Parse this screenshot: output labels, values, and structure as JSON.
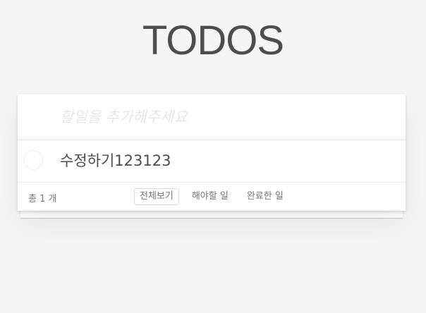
{
  "app": {
    "title": "TODOS"
  },
  "new_todo": {
    "placeholder": "할일을 추가해주세요",
    "value": ""
  },
  "todos": [
    {
      "label": "수정하기123123",
      "completed": false
    }
  ],
  "footer": {
    "count_text": "총 1 개",
    "filters": [
      {
        "label": "전체보기",
        "selected": true
      },
      {
        "label": "해야할 일",
        "selected": false
      },
      {
        "label": "완료한 일",
        "selected": false
      }
    ]
  },
  "colors": {
    "background": "#f5f5f5",
    "title": "#4d4d4d",
    "placeholder": "#e6e6e6",
    "text": "#4d4d4d",
    "muted": "#777777",
    "border": "#ededed"
  }
}
